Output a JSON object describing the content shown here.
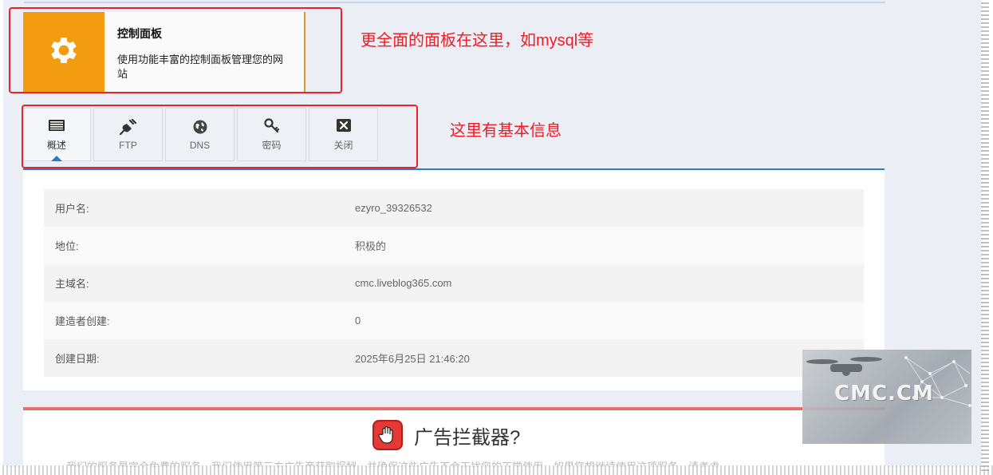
{
  "control_panel": {
    "title": "控制面板",
    "description": "使用功能丰富的控制面板管理您的网站",
    "icon": "gear-icon"
  },
  "annotations": {
    "panel_note": "更全面的面板在这里，如mysql等",
    "tabs_note": "这里有基本信息"
  },
  "tabs": [
    {
      "label": "概述",
      "icon": "overview-icon",
      "active": true
    },
    {
      "label": "FTP",
      "icon": "plug-icon"
    },
    {
      "label": "DNS",
      "icon": "globe-icon"
    },
    {
      "label": "密码",
      "icon": "key-icon"
    },
    {
      "label": "关闭",
      "icon": "close-box-icon"
    }
  ],
  "info": [
    {
      "label": "用户名:",
      "value": "ezyro_39326532"
    },
    {
      "label": "地位:",
      "value": "积极的"
    },
    {
      "label": "主域名:",
      "value": "cmc.liveblog365.com"
    },
    {
      "label": "建造者创建:",
      "value": "0"
    },
    {
      "label": "创建日期:",
      "value": "2025年6月25日 21:46:20"
    }
  ],
  "ad_blocker": {
    "title": "广告拦截器?",
    "description": "我们的服务是完全免费的服务，我们使用第三方广告商获取报酬，并确保这些广告不会干扰您的正常使用。如果您想继续使用这项服务，请考虑..."
  },
  "watermark": {
    "text": "CMC.CM"
  },
  "colors": {
    "accent_orange": "#f39c12",
    "annotation_red": "#e8232b",
    "tab_active_blue": "#2a7dc9",
    "ad_border_red": "#ef6a6a"
  }
}
